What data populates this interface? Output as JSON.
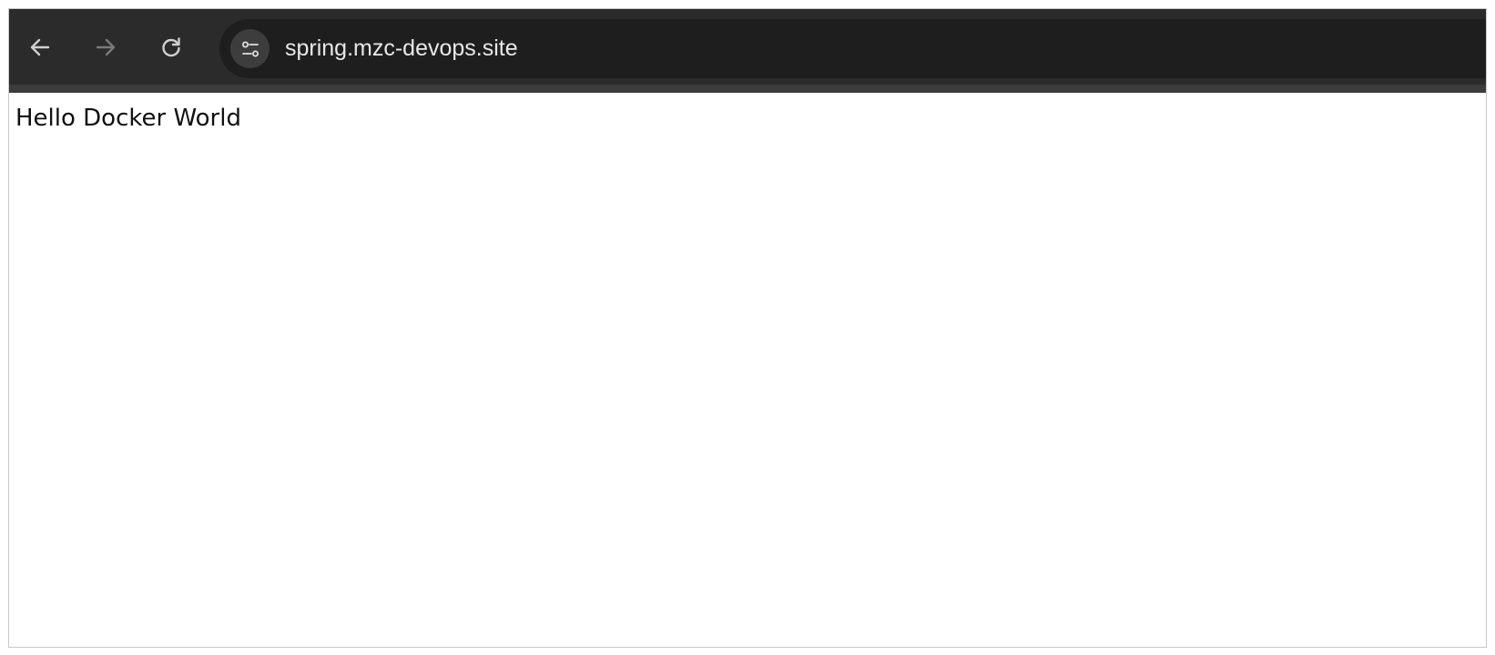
{
  "browser": {
    "back_icon": "arrow-left-icon",
    "forward_icon": "arrow-right-icon",
    "reload_icon": "reload-icon",
    "site_info_icon": "tune-icon",
    "url": "spring.mzc-devops.site",
    "colors": {
      "toolbar": "#2b2b2b",
      "omnibox": "#1e1e1e",
      "url_text": "#e8e8e8",
      "icon_active": "#d0d0d0",
      "icon_disabled": "#7a7a7a"
    }
  },
  "page": {
    "body_text": "Hello Docker World"
  }
}
